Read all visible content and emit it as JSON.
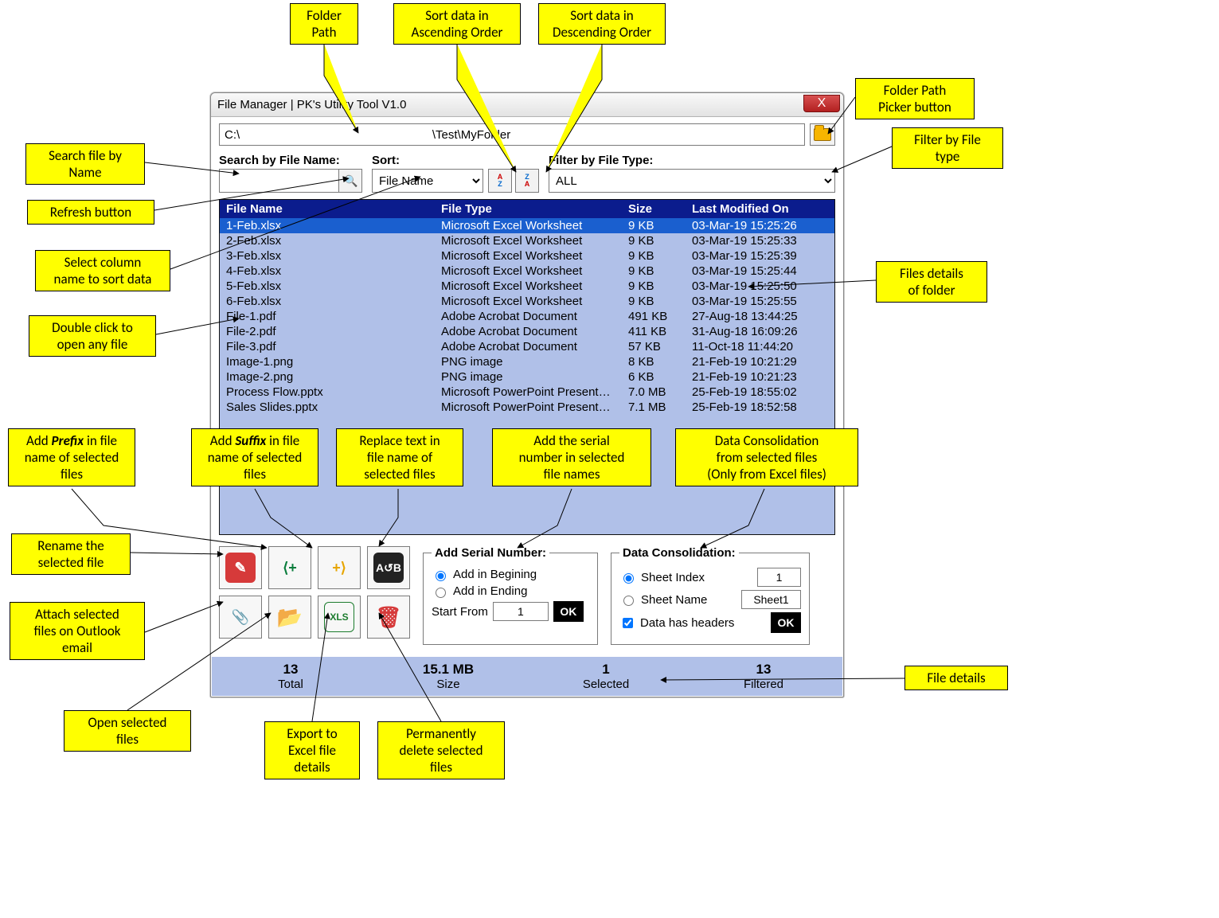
{
  "window": {
    "title": "File Manager | PK's Utility Tool V1.0",
    "close_symbol": "X"
  },
  "path": {
    "value": "C:\\                                                          \\Test\\MyFolder"
  },
  "search": {
    "label": "Search by File Name:",
    "button_glyph": "🔍"
  },
  "sort": {
    "label": "Sort:",
    "selected": "File Name",
    "asc_top": "A",
    "asc_bot": "Z",
    "desc_top": "Z",
    "desc_bot": "A"
  },
  "filter": {
    "label": "Filter by File Type:",
    "selected": "ALL"
  },
  "columns": {
    "name": "File Name",
    "type": "File Type",
    "size": "Size",
    "modified": "Last Modified On"
  },
  "rows": [
    {
      "name": "1-Feb.xlsx",
      "type": "Microsoft Excel Worksheet",
      "size": "9 KB",
      "modified": "03-Mar-19 15:25:26",
      "sel": true
    },
    {
      "name": "2-Feb.xlsx",
      "type": "Microsoft Excel Worksheet",
      "size": "9 KB",
      "modified": "03-Mar-19 15:25:33"
    },
    {
      "name": "3-Feb.xlsx",
      "type": "Microsoft Excel Worksheet",
      "size": "9 KB",
      "modified": "03-Mar-19 15:25:39"
    },
    {
      "name": "4-Feb.xlsx",
      "type": "Microsoft Excel Worksheet",
      "size": "9 KB",
      "modified": "03-Mar-19 15:25:44"
    },
    {
      "name": "5-Feb.xlsx",
      "type": "Microsoft Excel Worksheet",
      "size": "9 KB",
      "modified": "03-Mar-19 15:25:50"
    },
    {
      "name": "6-Feb.xlsx",
      "type": "Microsoft Excel Worksheet",
      "size": "9 KB",
      "modified": "03-Mar-19 15:25:55"
    },
    {
      "name": "File-1.pdf",
      "type": "Adobe Acrobat Document",
      "size": "491 KB",
      "modified": "27-Aug-18 13:44:25"
    },
    {
      "name": "File-2.pdf",
      "type": "Adobe Acrobat Document",
      "size": "411 KB",
      "modified": "31-Aug-18 16:09:26"
    },
    {
      "name": "File-3.pdf",
      "type": "Adobe Acrobat Document",
      "size": "57 KB",
      "modified": "11-Oct-18 11:44:20"
    },
    {
      "name": "Image-1.png",
      "type": "PNG image",
      "size": "8 KB",
      "modified": "21-Feb-19 10:21:29"
    },
    {
      "name": "Image-2.png",
      "type": "PNG image",
      "size": "6 KB",
      "modified": "21-Feb-19 10:21:23"
    },
    {
      "name": "Process Flow.pptx",
      "type": "Microsoft PowerPoint Presentation",
      "size": "7.0 MB",
      "modified": "25-Feb-19 18:55:02"
    },
    {
      "name": "Sales Slides.pptx",
      "type": "Microsoft PowerPoint Presentation",
      "size": "7.1 MB",
      "modified": "25-Feb-19 18:52:58"
    }
  ],
  "serial": {
    "legend": "Add Serial Number:",
    "begin": "Add in Begining",
    "end": "Add in Ending",
    "start_label": "Start From",
    "start_value": "1",
    "ok": "OK"
  },
  "consol": {
    "legend": "Data Consolidation:",
    "sheet_index_label": "Sheet Index",
    "sheet_index_value": "1",
    "sheet_name_label": "Sheet Name",
    "sheet_name_value": "Sheet1",
    "headers_label": "Data has headers",
    "ok": "OK"
  },
  "footer": {
    "total_val": "13",
    "total_label": "Total",
    "size_val": "15.1 MB",
    "size_label": "Size",
    "selected_val": "1",
    "selected_label": "Selected",
    "filtered_val": "13",
    "filtered_label": "Filtered"
  },
  "callouts": {
    "folder_path": "Folder\nPath",
    "sort_asc": "Sort data in\nAscending Order",
    "sort_desc": "Sort data in\nDescending Order",
    "picker": "Folder Path\nPicker button",
    "filter": "Filter by File\ntype",
    "search": "Search file by\nName",
    "refresh": "Refresh button",
    "select_col": "Select column\nname to sort data",
    "dblclick": "Double click to\nopen any file",
    "details": "Files details\nof folder",
    "prefix_l": "Add ",
    "prefix_em": "Prefix",
    "prefix_r": " in file\nname of selected\nfiles",
    "suffix_l": "Add ",
    "suffix_em": "Suffix",
    "suffix_r": " in file\nname of selected\nfiles",
    "replace": "Replace text in\nfile name of\nselected files",
    "addserial": "Add the serial\nnumber in selected\nfile names",
    "consol": "Data Consolidation\nfrom selected files\n(Only from Excel files)",
    "rename": "Rename the\nselected file",
    "attach": "Attach  selected\nfiles on Outlook\nemail",
    "open": "Open selected\nfiles",
    "export": "Export to\nExcel file\ndetails",
    "delete": "Permanently\ndelete selected\nfiles",
    "file_details": "File details"
  }
}
